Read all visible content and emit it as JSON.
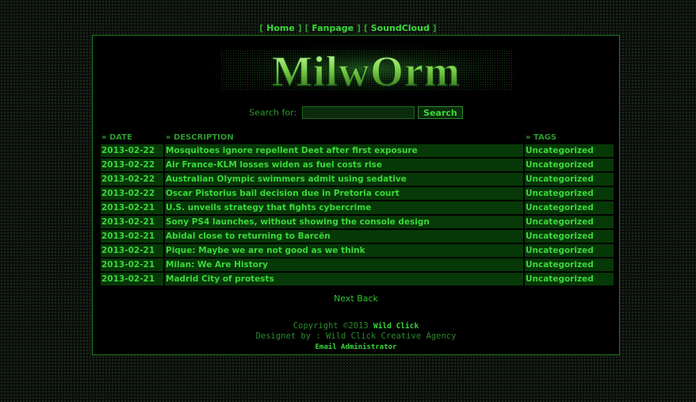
{
  "nav": {
    "items": [
      {
        "label": "Home"
      },
      {
        "label": "Fanpage"
      },
      {
        "label": "SoundCloud"
      }
    ]
  },
  "logo": {
    "text": "MilwOrm"
  },
  "search": {
    "label": "Search for:",
    "value": "",
    "button_label": "Search"
  },
  "table": {
    "headers": {
      "date": "» DATE",
      "description": "» DESCRIPTION",
      "tags": "» TAGS"
    },
    "rows": [
      {
        "date": "2013-02-22",
        "description": "Mosquitoes ignore repellent Deet after first exposure",
        "tag": "Uncategorized"
      },
      {
        "date": "2013-02-22",
        "description": "Air France-KLM losses widen as fuel costs rise",
        "tag": "Uncategorized"
      },
      {
        "date": "2013-02-22",
        "description": "Australian Olympic swimmers admit using sedative",
        "tag": "Uncategorized"
      },
      {
        "date": "2013-02-22",
        "description": "Oscar Pistorius bail decision due in Pretoria court",
        "tag": "Uncategorized"
      },
      {
        "date": "2013-02-21",
        "description": "U.S. unveils strategy that fights cybercrime",
        "tag": "Uncategorized"
      },
      {
        "date": "2013-02-21",
        "description": "Sony PS4 launches, without showing the console design",
        "tag": "Uncategorized"
      },
      {
        "date": "2013-02-21",
        "description": "Abidal close to returning to Barcën",
        "tag": "Uncategorized"
      },
      {
        "date": "2013-02-21",
        "description": "Pique: Maybe we are not good as we think",
        "tag": "Uncategorized"
      },
      {
        "date": "2013-02-21",
        "description": "Milan: We Are History",
        "tag": "Uncategorized"
      },
      {
        "date": "2013-02-21",
        "description": "Madrid City of protests",
        "tag": "Uncategorized"
      }
    ]
  },
  "pager": {
    "next": "Next",
    "back": "Back"
  },
  "footer": {
    "copyright": "Copyright ©2013",
    "brand": "Wild Click",
    "designed": "Designet by : Wild Click Creative Agency",
    "email": "Email Administrator"
  },
  "colors": {
    "accent": "#3ad83a",
    "cell_bg": "#073807",
    "border": "#1c7a1c"
  }
}
